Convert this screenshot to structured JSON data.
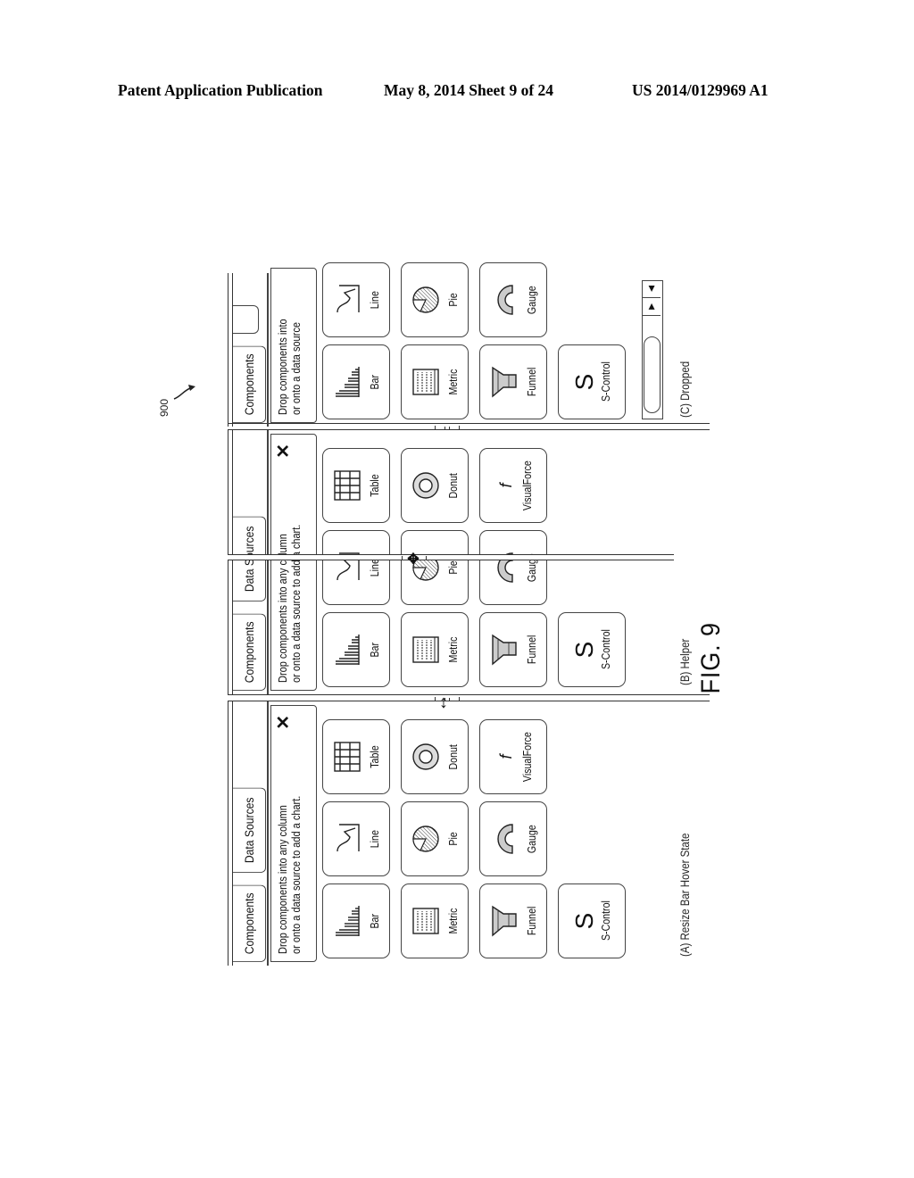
{
  "header": {
    "left": "Patent Application Publication",
    "middle": "May 8, 2014   Sheet 9 of 24",
    "right": "US 2014/0129969 A1"
  },
  "figure": {
    "reference_number": "900",
    "label": "FIG. 9",
    "panels": {
      "a": {
        "caption": "(A) Resize Bar Hover State",
        "tabs": [
          "Components",
          "Data Sources"
        ],
        "helper_lines": [
          "Drop components into any column",
          "or onto a data source to add a chart."
        ],
        "close_icon": "close-x-icon",
        "tiles": [
          {
            "label": "Bar",
            "icon": "bar-chart-icon"
          },
          {
            "label": "Line",
            "icon": "line-chart-icon"
          },
          {
            "label": "Table",
            "icon": "table-icon"
          },
          {
            "label": "Metric",
            "icon": "metric-icon"
          },
          {
            "label": "Pie",
            "icon": "pie-chart-icon"
          },
          {
            "label": "Donut",
            "icon": "donut-chart-icon"
          },
          {
            "label": "Funnel",
            "icon": "funnel-chart-icon"
          },
          {
            "label": "Gauge",
            "icon": "gauge-icon"
          },
          {
            "label": "VisualForce",
            "icon": "visualforce-icon",
            "glyph": "f"
          },
          {
            "label": "S-Control",
            "icon": "s-control-icon",
            "glyph": "S"
          }
        ],
        "cursor_icon": "resize-vertical-cursor-icon"
      },
      "b": {
        "caption": "(B) Helper",
        "tabs": [
          "Components",
          "Data Sources"
        ],
        "helper_lines": [
          "Drop components into any column",
          "or onto a data source to add a chart."
        ],
        "close_icon": "close-x-icon",
        "tiles": [
          {
            "label": "Bar"
          },
          {
            "label": "Line"
          },
          {
            "label": "Table"
          },
          {
            "label": "Metric"
          },
          {
            "label": "Pie"
          },
          {
            "label": "Donut"
          },
          {
            "label": "Funnel"
          },
          {
            "label": "Gauge"
          },
          {
            "label": "VisualForce",
            "glyph": "f"
          },
          {
            "label": "S-Control",
            "glyph": "S"
          }
        ],
        "cursor_icon": "drag-move-cursor-icon"
      },
      "c": {
        "caption": "(C) Dropped",
        "tabs": [
          "Components"
        ],
        "helper_lines": [
          "Drop components into",
          "or onto a data source"
        ],
        "tiles": [
          {
            "label": "Bar"
          },
          {
            "label": "Line"
          },
          {
            "label": "Metric"
          },
          {
            "label": "Pie"
          },
          {
            "label": "Funnel"
          },
          {
            "label": "Gauge"
          },
          {
            "label": "S-Control",
            "glyph": "S"
          }
        ],
        "scroll_up": "▲",
        "scroll_down": "▼"
      }
    }
  }
}
